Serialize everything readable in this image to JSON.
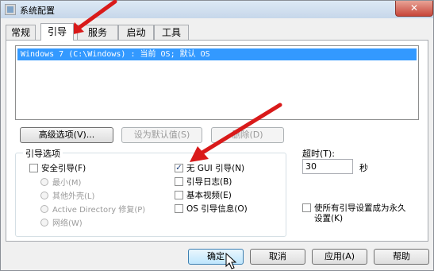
{
  "window": {
    "title": "系统配置",
    "close_glyph": "✕"
  },
  "tabs": [
    {
      "label": "常规",
      "active": false
    },
    {
      "label": "引导",
      "active": true
    },
    {
      "label": "服务",
      "active": false
    },
    {
      "label": "启动",
      "active": false
    },
    {
      "label": "工具",
      "active": false
    }
  ],
  "boot_list": {
    "entries": [
      {
        "text": "Windows 7 (C:\\Windows) : 当前 OS; 默认 OS",
        "selected": true
      }
    ]
  },
  "entry_buttons": {
    "advanced": "高级选项(V)...",
    "set_default": "设为默认值(S)",
    "delete": "删除(D)"
  },
  "boot_options": {
    "title": "引导选项",
    "safe_boot": {
      "label": "安全引导(F)",
      "checked": false
    },
    "radios": [
      {
        "label": "最小(M)"
      },
      {
        "label": "其他外壳(L)"
      },
      {
        "label": "Active Directory 修复(P)"
      },
      {
        "label": "网络(W)"
      }
    ],
    "right_checks": [
      {
        "label": "无 GUI 引导(N)",
        "checked": true
      },
      {
        "label": "引导日志(B)",
        "checked": false
      },
      {
        "label": "基本视频(E)",
        "checked": false
      },
      {
        "label": "OS 引导信息(O)",
        "checked": false
      }
    ]
  },
  "timeout": {
    "label": "超时(T):",
    "value": "30",
    "unit": "秒"
  },
  "permanent": {
    "label_line1": "使所有引导设置成为永久",
    "label_line2": "设置(K)",
    "checked": false
  },
  "footer_buttons": {
    "ok": "确定",
    "cancel": "取消",
    "apply": "应用(A)",
    "help": "帮助"
  },
  "colors": {
    "accent": "#3399ff",
    "arrow": "#d91a1a",
    "close": "#c7463a"
  },
  "icons": {
    "app": "system-config-icon",
    "close": "close-icon",
    "annotation": "red-arrow-icon",
    "cursor": "mouse-cursor-icon"
  }
}
